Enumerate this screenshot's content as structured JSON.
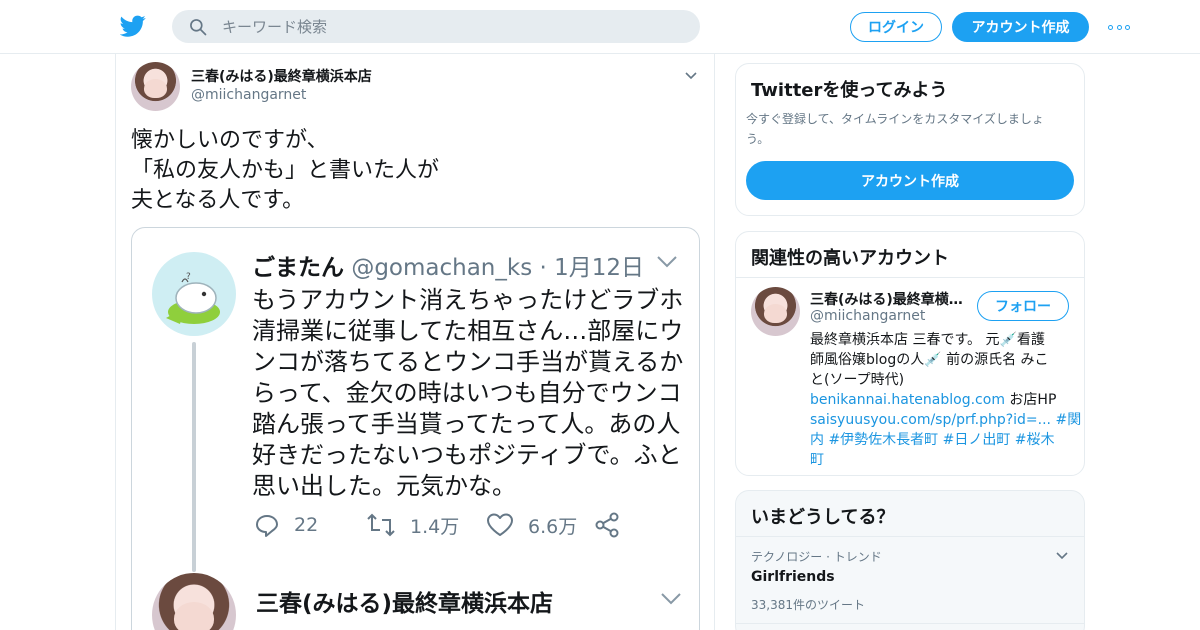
{
  "nav": {
    "search_placeholder": "キーワード検索",
    "login_label": "ログイン",
    "signup_label": "アカウント作成",
    "logo_icon": "twitter-bird-icon",
    "more_icon": "more-dots-icon"
  },
  "tweet": {
    "author_name": "三春(みはる)最終章横浜本店",
    "author_handle": "@miichangarnet",
    "text_lines": [
      "懐かしいのですが、",
      "「私の友人かも」と書いた人が",
      "夫となる人です。"
    ],
    "quoted": {
      "author_name": "ごまたん",
      "author_handle": "@gomachan_ks · 1月12日",
      "body_lines": [
        "もうアカウント消えちゃったけどラブホ",
        "清掃業に従事してた相互さん…部屋にウ",
        "ンコが落ちてるとウンコ手当が貰えるか",
        "らって、金欠の時はいつも自分でウンコ",
        "踏ん張って手当貰ってたって人。あの人",
        "好きだったないつもポジティブで。ふと",
        "思い出した。元気かな。"
      ],
      "reply_count": "22",
      "retweet_count": "1.4万",
      "like_count": "6.6万",
      "next_author_name": "三春(みはる)最終章横浜本店"
    }
  },
  "sidebar": {
    "signup_card": {
      "title": "Twitterを使ってみよう",
      "subtitle_lines": [
        "今すぐ登録して、タイムラインをカスタマイズしましょ",
        "う。"
      ],
      "button_label": "アカウント作成"
    },
    "related": {
      "title": "関連性の高いアカウント",
      "name": "三春(みはる)最終章横浜本店",
      "handle": "@miichangarnet",
      "follow_label": "フォロー",
      "bio_line1": "最終章横浜本店 三春です。 元💉看護",
      "bio_line2": "師風俗嬢blogの人💉 前の源氏名 みこ",
      "bio_line3": "と(ソープ時代)",
      "bio_link1": "benikannai.hatenablog.com",
      "bio_text4": " お店HP",
      "bio_link2": "saisyuusyou.com/sp/prf.php?id=...",
      "bio_tag1": " #関",
      "bio_tag1b": "内",
      "bio_tags_line": " #伊勢佐木長者町 #日ノ出町 #桜木",
      "bio_tag_end": "町"
    },
    "trends": {
      "title": "いまどうしてる？",
      "category": "テクノロジー · トレンド",
      "topic": "Girlfriends",
      "count": "33,381件のツイート"
    }
  },
  "colors": {
    "accent": "#1da1f2",
    "text": "#14171a",
    "muted": "#657786",
    "border": "#e6ecf0"
  }
}
